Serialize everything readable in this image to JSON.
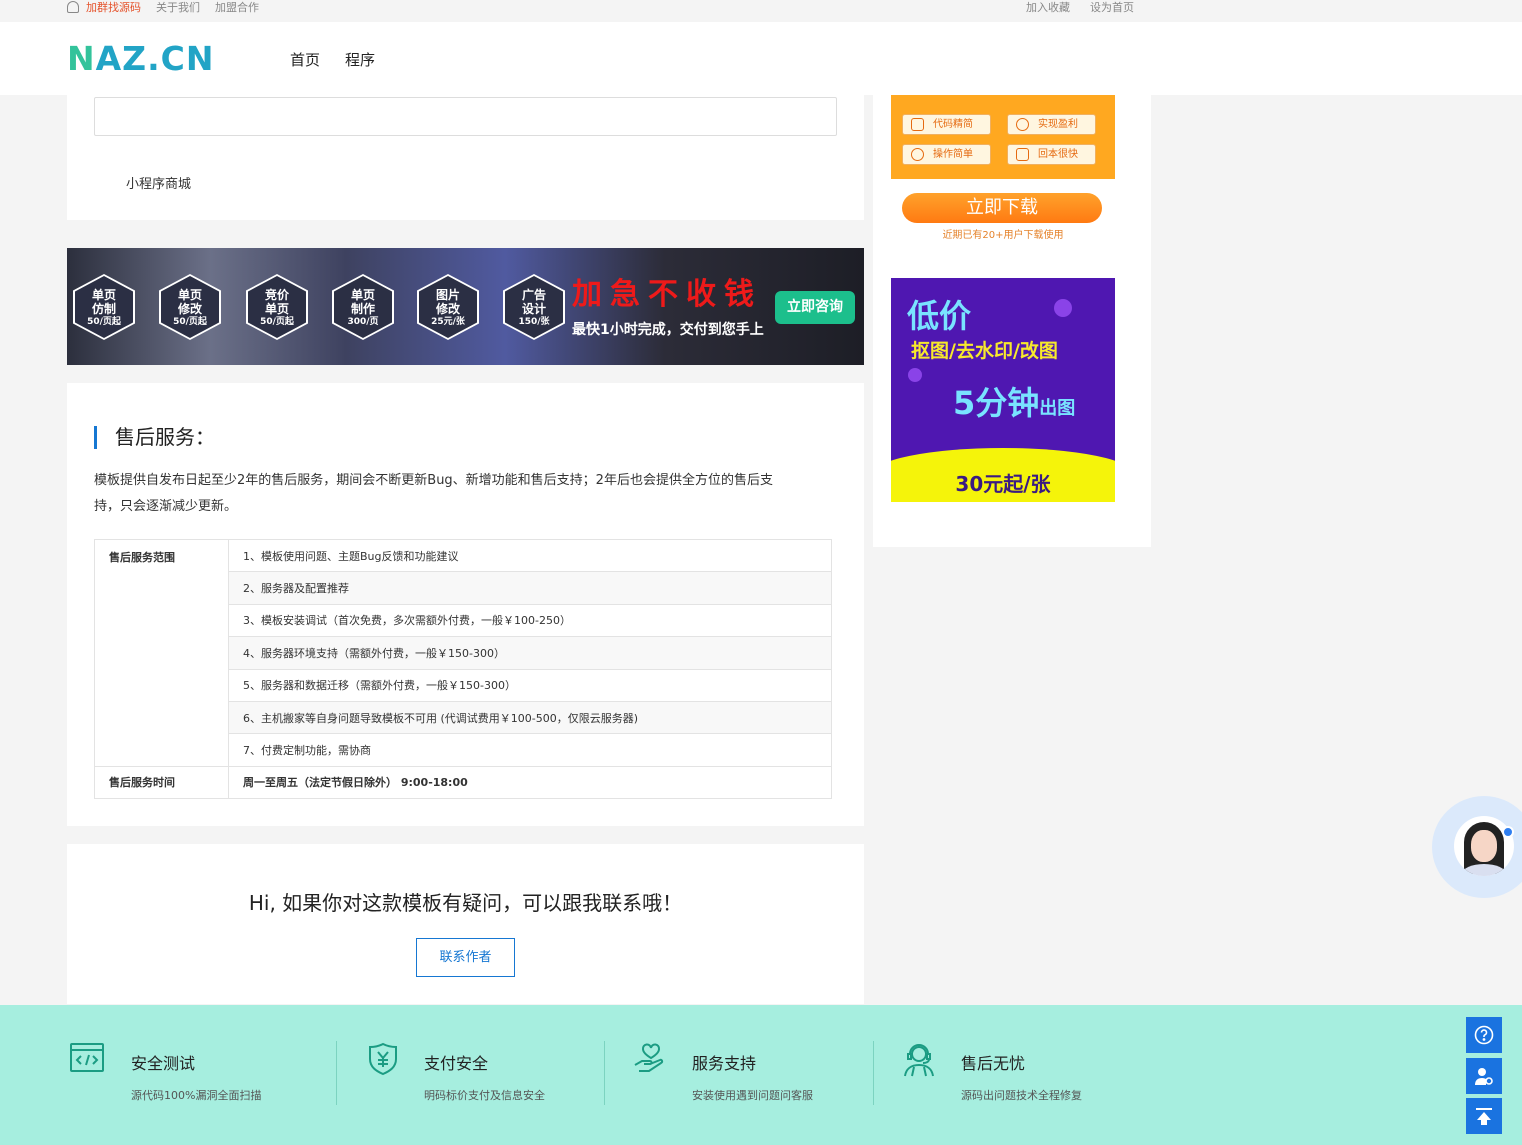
{
  "topbar": {
    "left_links": [
      "加群找源码",
      "关于我们",
      "加盟合作"
    ],
    "right_links": [
      "加入收藏",
      "设为首页"
    ]
  },
  "header": {
    "logo_part1": "N",
    "logo_part2": "AZ.CN",
    "nav": [
      "首页",
      "程序"
    ]
  },
  "product": {
    "tag": "小程序商城"
  },
  "banner": {
    "hexes": [
      {
        "l1": "单页",
        "l2": "仿制",
        "price": "50/页起"
      },
      {
        "l1": "单页",
        "l2": "修改",
        "price": "50/页起"
      },
      {
        "l1": "竞价",
        "l2": "单页",
        "price": "50/页起"
      },
      {
        "l1": "单页",
        "l2": "制作",
        "price": "300/页"
      },
      {
        "l1": "图片",
        "l2": "修改",
        "price": "25元/张"
      },
      {
        "l1": "广告",
        "l2": "设计",
        "price": "150/张"
      }
    ],
    "title": "加急不收钱",
    "subtitle": "最快1小时完成，交付到您手上",
    "button": "立即咨询"
  },
  "after_sales": {
    "title": "售后服务：",
    "description": "模板提供自发布日起至少2年的售后服务，期间会不断更新Bug、新增功能和售后支持；2年后也会提供全方位的售后支持，只会逐渐减少更新。",
    "scope_label": "售后服务范围",
    "scope_items": [
      "1、模板使用问题、主题Bug反馈和功能建议",
      "2、服务器及配置推荐",
      "3、模板安装调试（首次免费，多次需额外付费，一般￥100-250）",
      "4、服务器环境支持（需额外付费，一般￥150-300）",
      "5、服务器和数据迁移（需额外付费，一般￥150-300）",
      "6、主机搬家等自身问题导致模板不可用 (代调试费用￥100-500，仅限云服务器)",
      "7、付费定制功能，需协商"
    ],
    "time_label": "售后服务时间",
    "time_value": "周一至周五（法定节假日除外） 9:00-18:00"
  },
  "contact": {
    "question": "Hi, 如果你对这款模板有疑问，可以跟我联系哦！",
    "button": "联系作者"
  },
  "sidebar": {
    "ad1_pills": [
      "代码精简",
      "实现盈利",
      "操作简单",
      "回本很快"
    ],
    "download_button": "立即下载",
    "download_note": "近期已有20+用户下载使用",
    "ad2": {
      "line1": "低价",
      "line2": "抠图/去水印/改图",
      "line3_big": "5分钟",
      "line3_small": "出图",
      "line4": "30元起/张"
    }
  },
  "footer": {
    "features": [
      {
        "title": "安全测试",
        "desc": "源代码100%漏洞全面扫描",
        "icon": "code-window-icon"
      },
      {
        "title": "支付安全",
        "desc": "明码标价支付及信息安全",
        "icon": "yen-shield-icon"
      },
      {
        "title": "服务支持",
        "desc": "安装使用遇到问题问客服",
        "icon": "heart-hand-icon"
      },
      {
        "title": "售后无忧",
        "desc": "源码出问题技术全程修复",
        "icon": "headset-agent-icon"
      }
    ]
  },
  "colors": {
    "accent": "#1677d2",
    "footer_bg": "#a6eedf",
    "hot_link": "#e5532c"
  }
}
